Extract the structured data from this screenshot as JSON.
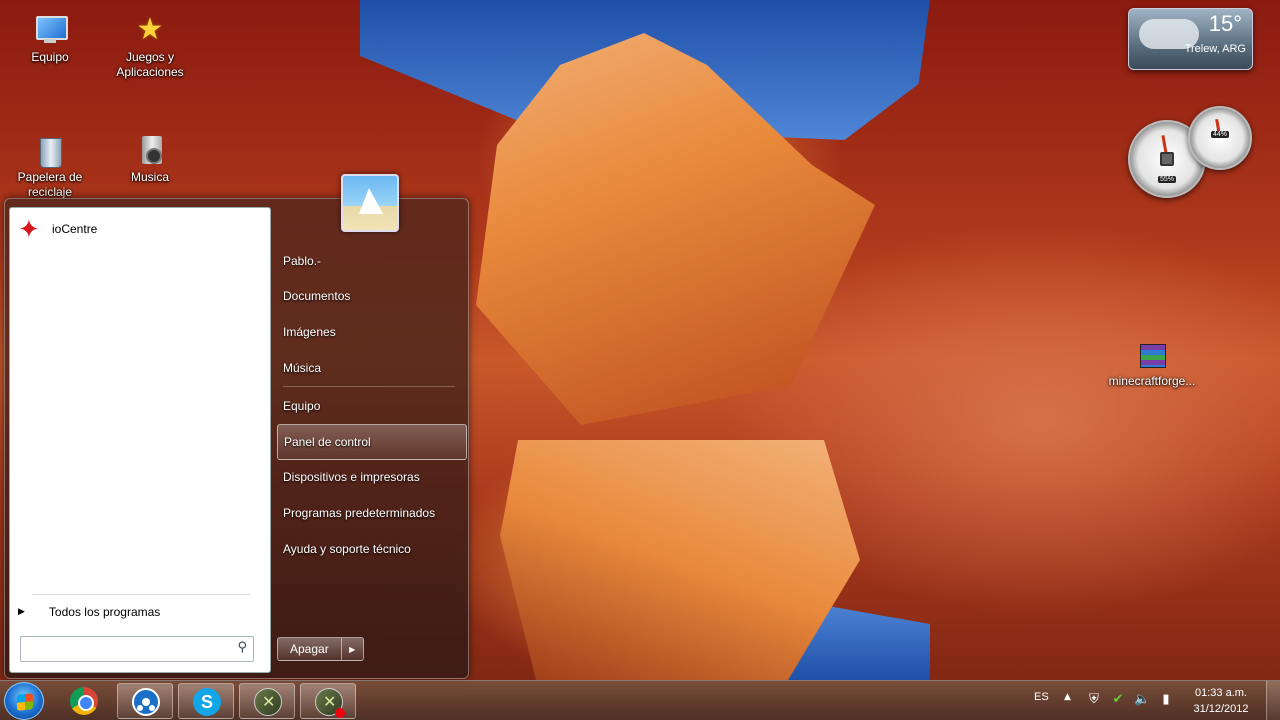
{
  "desktop": {
    "icons": [
      {
        "label": "Equipo",
        "icon": "computer-icon"
      },
      {
        "label": "Juegos y Aplicaciones",
        "icon": "star-icon"
      },
      {
        "label": "Papelera de reciclaje",
        "icon": "recycle-bin-icon"
      },
      {
        "label": "Musica",
        "icon": "speaker-icon"
      },
      {
        "label": "minecraftforge...",
        "icon": "winrar-archive-icon"
      }
    ]
  },
  "gadgets": {
    "weather": {
      "temp": "15°",
      "location": "Trelew, ARG"
    },
    "cpu_meter": {
      "cpu": "55%",
      "memory": "44%"
    }
  },
  "start_menu": {
    "pinned": [
      {
        "label": "ioCentre",
        "icon": "iocentre-icon"
      }
    ],
    "all_programs_label": "Todos los programas",
    "search_placeholder": "",
    "right_links": [
      "Pablo.-",
      "Documentos",
      "Imágenes",
      "Música",
      "Equipo",
      "Panel de control",
      "Dispositivos e impresoras",
      "Programas predeterminados",
      "Ayuda y soporte técnico"
    ],
    "highlighted": "Panel de control",
    "shutdown_label": "Apagar"
  },
  "taskbar": {
    "pinned": [
      "chrome-icon",
      "hub-icon",
      "skype-icon",
      "game-icon",
      "game-recording-icon"
    ],
    "skype_letter": "S",
    "tray": {
      "language": "ES",
      "time": "01:33 a.m.",
      "date": "31/12/2012"
    }
  }
}
